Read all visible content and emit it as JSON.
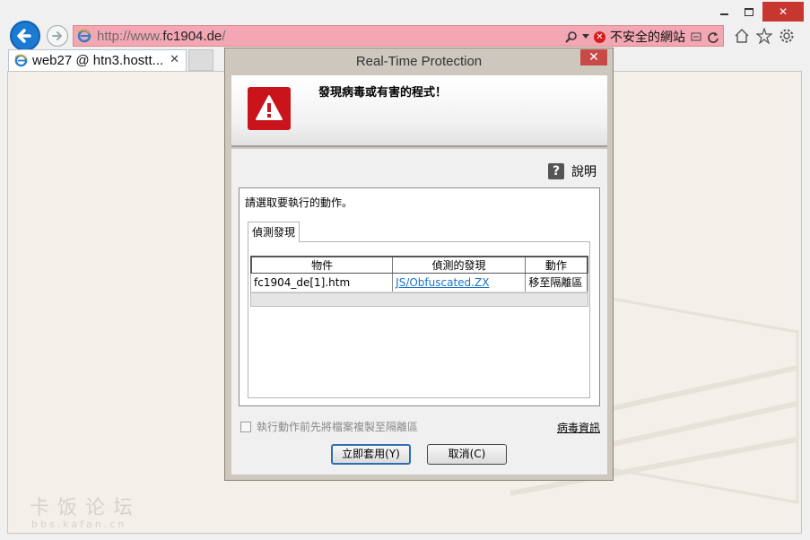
{
  "browser": {
    "url_prefix": "http://www.",
    "url_domain": "fc1904.de",
    "url_suffix": "/",
    "security_warning": "不安全的網站",
    "tab_title": "web27 @ htn3.hostt...",
    "tab_close": "✕",
    "close_glyph": "✕"
  },
  "dialog": {
    "title": "Real-Time Protection",
    "close_glyph": "✕",
    "alert_message": "發現病毒或有害的程式！",
    "help_glyph": "?",
    "help_label": "說明",
    "prompt": "請選取要執行的動作。",
    "tab_label": "偵測發現",
    "table": {
      "headers": [
        "物件",
        "偵測的發現",
        "動作"
      ],
      "rows": [
        {
          "object": "fc1904_de[1].htm",
          "detection": "JS/Obfuscated.ZX",
          "action": "移至隔離區"
        }
      ]
    },
    "checkbox_label": "執行動作前先將檔案複製至隔離區",
    "virus_info_link": "病毒資訊",
    "apply_button": "立即套用(Y)",
    "cancel_button": "取消(C)"
  },
  "watermark": {
    "title": "卡饭论坛",
    "subtitle": "bbs.kafan.cn"
  },
  "colors": {
    "address_bar_insecure": "#f3a7b3",
    "back_button": "#1c7ad3",
    "alert_red": "#c9141b",
    "link_blue": "#1a73c9",
    "window_close": "#c7372f"
  }
}
